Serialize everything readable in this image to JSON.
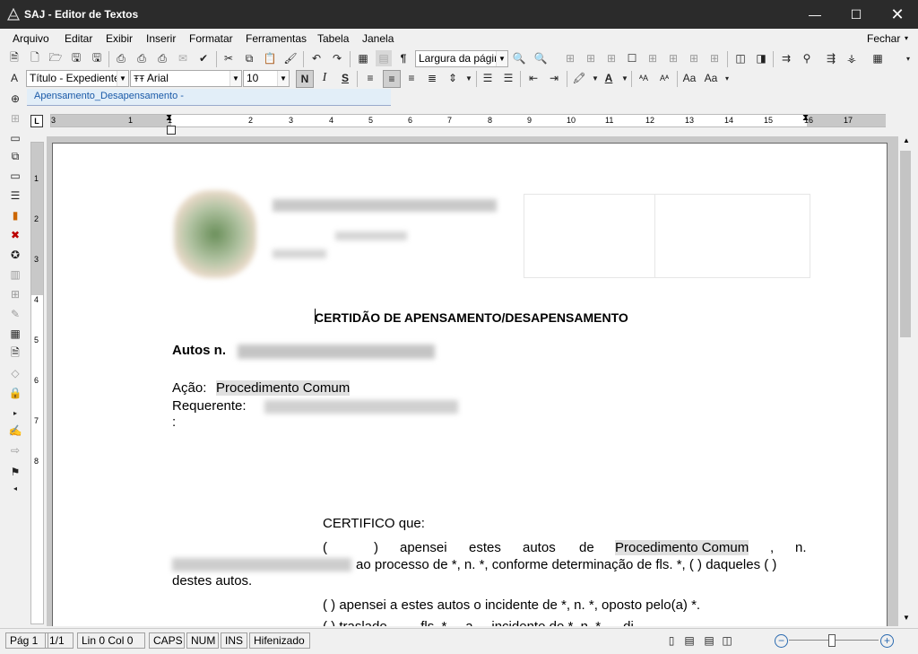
{
  "window": {
    "title": "SAJ - Editor de Textos",
    "minimize": "—",
    "maximize": "☐",
    "close": "✕"
  },
  "menu": {
    "items": [
      "Arquivo",
      "Editar",
      "Exibir",
      "Inserir",
      "Formatar",
      "Ferramentas",
      "Tabela",
      "Janela"
    ],
    "close_label": "Fechar"
  },
  "toolbar": {
    "zoom_value": "Largura da págin",
    "style_value": "Título - Expediente",
    "font_value": "Arial",
    "size_value": "10",
    "bold_label": "N",
    "italic_label": "I",
    "underline_label": "S"
  },
  "document_tab": {
    "label": "Apensamento_Desapensamento -"
  },
  "ruler": {
    "h_labels": [
      "3",
      "1",
      "1",
      "2",
      "3",
      "4",
      "5",
      "6",
      "7",
      "8",
      "9",
      "10",
      "11",
      "12",
      "13",
      "14",
      "15",
      "16",
      "17"
    ],
    "v_labels": [
      "1",
      "2",
      "3",
      "4",
      "5",
      "6",
      "7",
      "8"
    ]
  },
  "document": {
    "heading": "CERTIDÃO DE APENSAMENTO/DESAPENSAMENTO",
    "autos_label": "Autos n.",
    "acao_label": "Ação:",
    "acao_value": "Procedimento Comum",
    "requerente_label": "Requerente:",
    "colon": ":",
    "certifico": "CERTIFICO que:",
    "p1_a": "(",
    "p1_b": ")",
    "p1_c": "apensei",
    "p1_d": "estes",
    "p1_e": "autos",
    "p1_f": "de",
    "p1_g": "Procedimento Comum",
    "p1_h": ",",
    "p1_i": "n.",
    "p1_line2": "ao processo de *, n. *, conforme determinação de fls. *, (  ) daqueles (  )",
    "p1_line3": "destes autos.",
    "p2": "(           ) apensei a estes autos o incidente de *, n. *, oposto pelo(a) *.",
    "p3": "(           ) traslado ... ... fls. * ... a ... incidente de *, n. *, ... di"
  },
  "status": {
    "page": "Pág 1",
    "pages": "1/1",
    "position": "Lin 0  Col 0",
    "caps": "CAPS",
    "num": "NUM",
    "ins": "INS",
    "hyphen": "Hifenizado"
  }
}
